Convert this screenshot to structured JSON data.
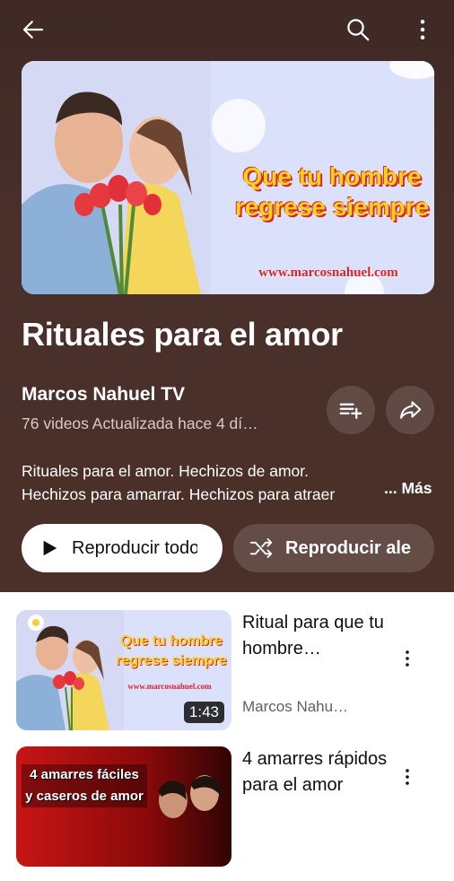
{
  "topbar": {
    "back_icon": "arrow-left-icon",
    "search_icon": "search-icon",
    "more_icon": "more-vert-icon"
  },
  "hero": {
    "headline_line1": "Que tu hombre",
    "headline_line2": "regrese siempre",
    "url": "www.marcosnahuel.com"
  },
  "playlist": {
    "title": "Rituales para el amor",
    "channel": "Marcos Nahuel TV",
    "meta": "76 videos  Actualizada hace 4 dí…",
    "description": "Rituales para el amor. Hechizos de amor. Hechizos para amarrar. Hechizos para atraer",
    "more_label": "... Más",
    "play_all_label": "Reproducir todo",
    "shuffle_label": "Reproducir aleatoriamente"
  },
  "videos": [
    {
      "title": "Ritual para que tu hombre…",
      "channel": "Marcos Nahu…",
      "duration": "1:43",
      "thumb_line1": "Que tu hombre",
      "thumb_line2": "regrese siempre",
      "thumb_url": "www.marcosnahuel.com"
    },
    {
      "title": "4 amarres rápidos para el amor",
      "channel": "",
      "duration": "",
      "thumb_line1": "4 amarres fáciles",
      "thumb_line2": "y caseros de amor"
    }
  ],
  "colors": {
    "header_bg": "#4b3029",
    "accent_yellow": "#f7d21c",
    "accent_red": "#e0202a"
  }
}
